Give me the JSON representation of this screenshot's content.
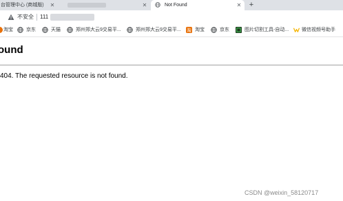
{
  "tabs": [
    {
      "label": "台管理中心 (商城版)",
      "close_glyph": "✕"
    },
    {
      "label": "",
      "close_glyph": "✕"
    },
    {
      "label": "Not Found",
      "close_glyph": "✕"
    }
  ],
  "new_tab_glyph": "+",
  "address_bar": {
    "security_label": "不安全",
    "url_visible": "111"
  },
  "bookmarks": [
    {
      "label": "淘宝",
      "icon": "taobao-icon"
    },
    {
      "label": "京东",
      "icon": "globe-icon"
    },
    {
      "label": "天猫",
      "icon": "globe-icon"
    },
    {
      "label": "郑州郑大云9交易平...",
      "icon": "globe-icon"
    },
    {
      "label": "郑州郑大云9交易平...",
      "icon": "globe-icon"
    },
    {
      "label": "淘宝",
      "icon": "taobao-icon"
    },
    {
      "label": "京东",
      "icon": "globe-icon"
    },
    {
      "label": "图片切割工具-自动...",
      "icon": "image-tool-icon"
    },
    {
      "label": "微信视频号助手",
      "icon": "wechat-channels-icon"
    }
  ],
  "page": {
    "title": "ound",
    "message": "404. The requested resource is not found."
  },
  "watermark": "CSDN @weixin_58120717",
  "colors": {
    "tab_strip": "#dee1e6",
    "taobao_orange": "#e8710a",
    "tool_green": "#1e8e3e",
    "wechat_yellow": "#f5b400"
  }
}
